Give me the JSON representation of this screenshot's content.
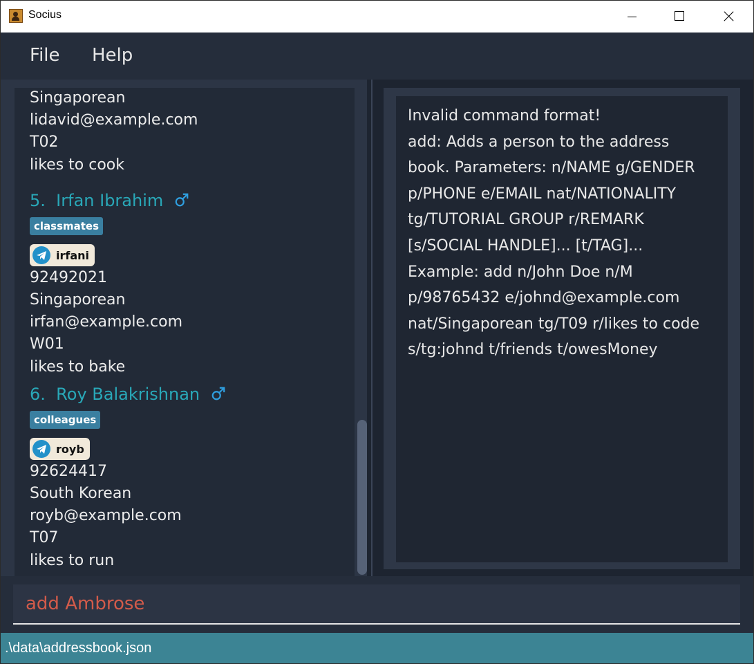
{
  "window": {
    "title": "Socius"
  },
  "menu": {
    "file_label": "File",
    "help_label": "Help"
  },
  "persons": {
    "partial": {
      "nationality": "Singaporean",
      "email": "lidavid@example.com",
      "tutorial_group": "T02",
      "remark": "likes to cook"
    },
    "p5": {
      "index": "5.",
      "name": "Irfan Ibrahim",
      "gender_icon": "male-gender-icon",
      "tag": "classmates",
      "social_icon": "telegram-icon",
      "handle": "irfani",
      "phone": "92492021",
      "nationality": "Singaporean",
      "email": "irfan@example.com",
      "tutorial_group": "W01",
      "remark": "likes to bake"
    },
    "p6": {
      "index": "6.",
      "name": "Roy Balakrishnan",
      "gender_icon": "male-gender-icon",
      "tag": "colleagues",
      "social_icon": "telegram-icon",
      "handle": "royb",
      "phone": "92624417",
      "nationality": "South Korean",
      "email": "royb@example.com",
      "tutorial_group": "T07",
      "remark": "likes to run"
    }
  },
  "result_display": {
    "text": "Invalid command format!\nadd: Adds a person to the address\nbook. Parameters: n/NAME g/GENDER\np/PHONE e/EMAIL nat/NATIONALITY\ntg/TUTORIAL GROUP r/REMARK\n[s/SOCIAL HANDLE]... [t/TAG]...\nExample: add n/John Doe n/M\np/98765432 e/johnd@example.com\nnat/Singaporean tg/T09 r/likes to code\ns/tg:johnd t/friends t/owesMoney"
  },
  "command_box": {
    "value": "add Ambrose"
  },
  "status_bar": {
    "path": ".\\data\\addressbook.json"
  },
  "colors": {
    "name": "#29a8b8",
    "tag_bg": "#3a7fa0",
    "command_text": "#d35b4a",
    "status_bg": "#3c8494"
  }
}
